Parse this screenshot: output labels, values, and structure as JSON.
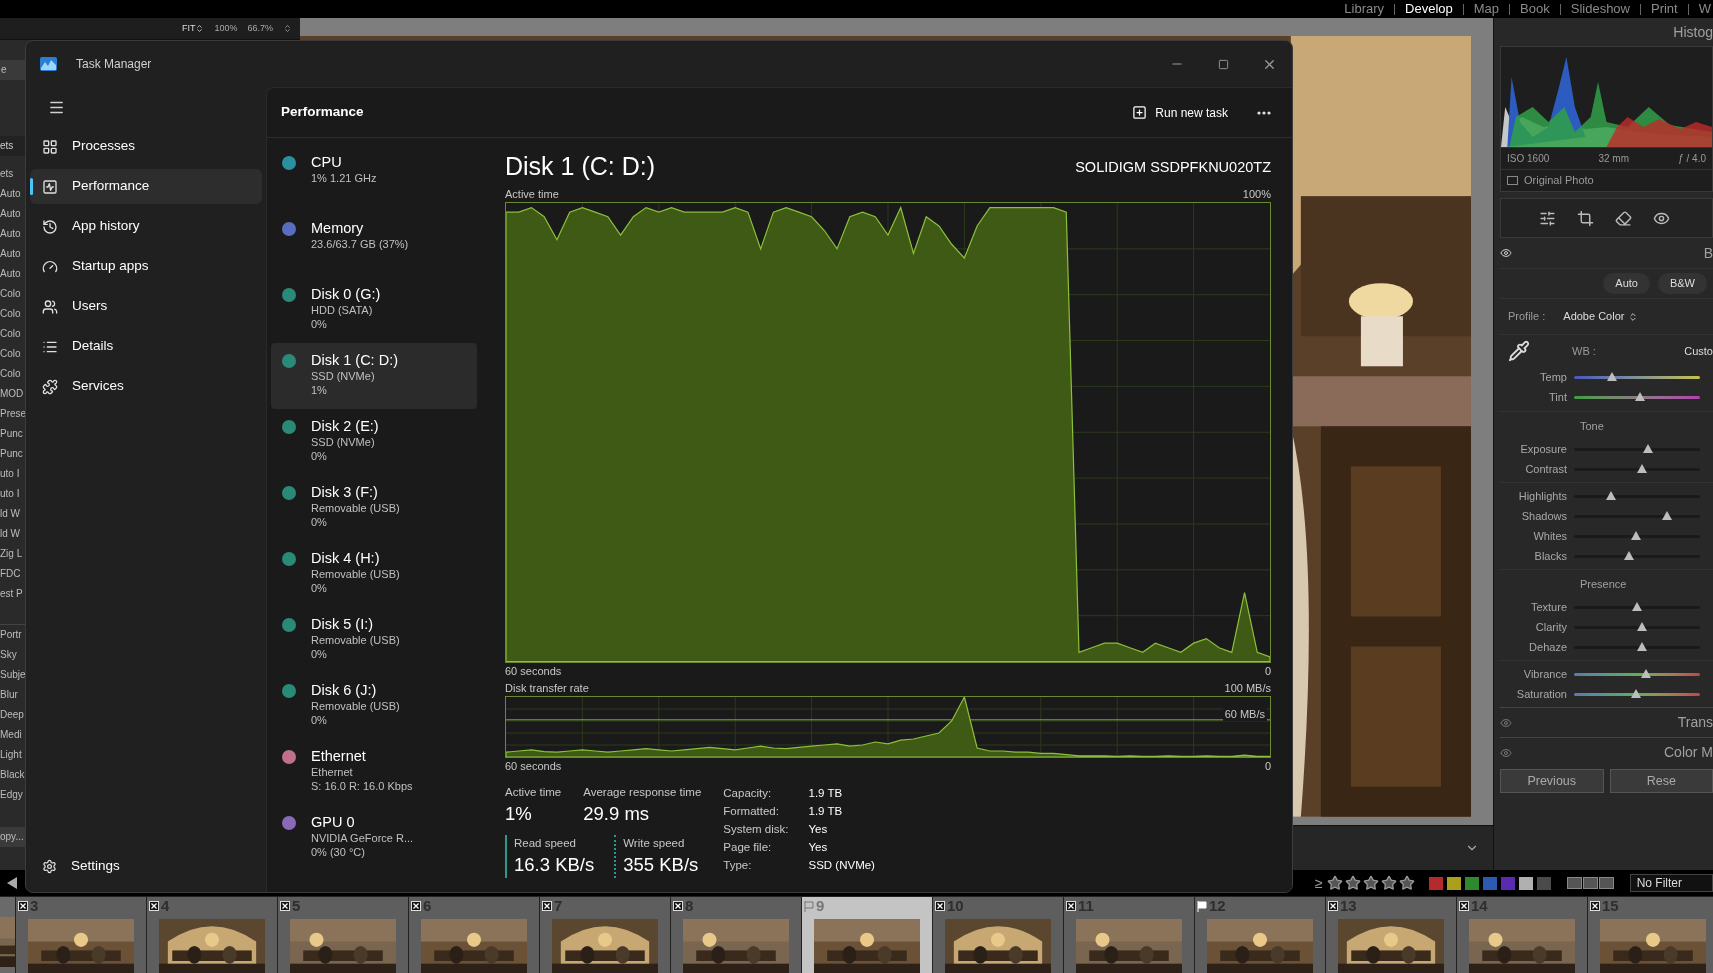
{
  "module_bar": [
    {
      "label": "Library",
      "selected": false
    },
    {
      "label": "Develop",
      "selected": true
    },
    {
      "label": "Map",
      "selected": false
    },
    {
      "label": "Book",
      "selected": false
    },
    {
      "label": "Slideshow",
      "selected": false
    },
    {
      "label": "Print",
      "selected": false
    },
    {
      "label": "W",
      "selected": false
    }
  ],
  "view_toolbar": {
    "fit": "FIT",
    "zoom_1": "100%",
    "zoom_2": "66.7%"
  },
  "left_panel": {
    "field_text": "e",
    "header": "ets",
    "items": [
      "ets",
      "Auto",
      "Auto",
      "Auto",
      "Auto",
      "Auto",
      "Colo",
      "Colo",
      "Colo",
      "Colo",
      "Colo",
      "MOD",
      "Prese",
      "Punc",
      "Punc",
      "uto I",
      "uto I",
      "ld W",
      "ld W",
      "Zig L",
      "FDC",
      "est P"
    ],
    "items_2": [
      "Portr",
      "Sky",
      "Subje",
      "Blur",
      "Deep",
      "Medi",
      "Light",
      "Black",
      "Edgy"
    ],
    "copy_button": "opy..."
  },
  "task_manager": {
    "title": "Task Manager",
    "nav": [
      {
        "label": "Processes",
        "selected": false
      },
      {
        "label": "Performance",
        "selected": true
      },
      {
        "label": "App history",
        "selected": false
      },
      {
        "label": "Startup apps",
        "selected": false
      },
      {
        "label": "Users",
        "selected": false
      },
      {
        "label": "Details",
        "selected": false
      },
      {
        "label": "Services",
        "selected": false
      }
    ],
    "settings": "Settings",
    "page_title": "Performance",
    "run_new_task": "Run new task",
    "devices": [
      {
        "name": "CPU",
        "lines": [
          "1% 1.21 GHz"
        ],
        "color": "#2a8fa0",
        "selected": false
      },
      {
        "name": "Memory",
        "lines": [
          "23.6/63.7 GB (37%)"
        ],
        "color": "#5a6cc0",
        "selected": false
      },
      {
        "name": "Disk 0 (G:)",
        "lines": [
          "HDD (SATA)",
          "0%"
        ],
        "color": "#2a8a78",
        "selected": false
      },
      {
        "name": "Disk 1 (C: D:)",
        "lines": [
          "SSD (NVMe)",
          "1%"
        ],
        "color": "#2a8a78",
        "selected": true
      },
      {
        "name": "Disk 2 (E:)",
        "lines": [
          "SSD (NVMe)",
          "0%"
        ],
        "color": "#2a8a78",
        "selected": false
      },
      {
        "name": "Disk 3 (F:)",
        "lines": [
          "Removable (USB)",
          "0%"
        ],
        "color": "#2a8a78",
        "selected": false
      },
      {
        "name": "Disk 4 (H:)",
        "lines": [
          "Removable (USB)",
          "0%"
        ],
        "color": "#2a8a78",
        "selected": false
      },
      {
        "name": "Disk 5 (I:)",
        "lines": [
          "Removable (USB)",
          "0%"
        ],
        "color": "#2a8a78",
        "selected": false
      },
      {
        "name": "Disk 6 (J:)",
        "lines": [
          "Removable (USB)",
          "0%"
        ],
        "color": "#2a8a78",
        "selected": false
      },
      {
        "name": "Ethernet",
        "lines": [
          "Ethernet",
          "S: 16.0 R: 16.0 Kbps"
        ],
        "color": "#c0708a",
        "selected": false
      },
      {
        "name": "GPU 0",
        "lines": [
          "NVIDIA GeForce R...",
          "0% (30 °C)"
        ],
        "color": "#8a6ab8",
        "selected": false
      }
    ],
    "detail": {
      "title": "Disk 1 (C: D:)",
      "model": "SOLIDIGM SSDPFKNU020TZ",
      "active_chart": {
        "title": "Active time",
        "max_label": "100%",
        "start_label": "60 seconds",
        "end_label": "0"
      },
      "transfer_chart": {
        "title": "Disk transfer rate",
        "max_label": "100 MB/s",
        "line_label": "60 MB/s",
        "start_label": "60 seconds",
        "end_label": "0"
      },
      "stats": [
        {
          "label": "Active time",
          "value": "1%"
        },
        {
          "label": "Average response time",
          "value": "29.9 ms"
        }
      ],
      "speeds": [
        {
          "label": "Read speed",
          "value": "16.3 KB/s",
          "kind": "solid"
        },
        {
          "label": "Write speed",
          "value": "355 KB/s",
          "kind": "dotted"
        }
      ],
      "properties": [
        {
          "label": "Capacity:",
          "value": "1.9 TB"
        },
        {
          "label": "Formatted:",
          "value": "1.9 TB"
        },
        {
          "label": "System disk:",
          "value": "Yes"
        },
        {
          "label": "Page file:",
          "value": "Yes"
        },
        {
          "label": "Type:",
          "value": "SSD (NVMe)"
        }
      ]
    }
  },
  "right_panel": {
    "histogram_title": "Histog",
    "exif": [
      "ISO 1600",
      "32 mm",
      "ƒ / 4.0"
    ],
    "original_photo": {
      "label": "Original Photo",
      "checked": false
    },
    "basic_title": "B",
    "buttons": [
      "Auto",
      "B&W"
    ],
    "profile_label": "Profile :",
    "profile_value": "Adobe Color",
    "wb_label": "WB :",
    "wb_value": "Custo",
    "wb_sliders": [
      {
        "label": "Temp",
        "kind": "temp",
        "level": 0.3
      },
      {
        "label": "Tint",
        "kind": "tint",
        "level": 0.52
      }
    ],
    "sections": [
      {
        "title": "Tone",
        "groups": [
          [
            {
              "label": "Exposure",
              "kind": "plain",
              "level": 0.59
            },
            {
              "label": "Contrast",
              "kind": "plain",
              "level": 0.54
            }
          ],
          [
            {
              "label": "Highlights",
              "kind": "plain",
              "level": 0.29
            },
            {
              "label": "Shadows",
              "kind": "plain",
              "level": 0.74
            },
            {
              "label": "Whites",
              "kind": "plain",
              "level": 0.49
            },
            {
              "label": "Blacks",
              "kind": "plain",
              "level": 0.44
            }
          ]
        ]
      },
      {
        "title": "Presence",
        "groups": [
          [
            {
              "label": "Texture",
              "kind": "plain",
              "level": 0.5
            },
            {
              "label": "Clarity",
              "kind": "plain",
              "level": 0.54
            },
            {
              "label": "Dehaze",
              "kind": "plain",
              "level": 0.54
            }
          ],
          [
            {
              "label": "Vibrance",
              "kind": "color",
              "level": 0.57
            },
            {
              "label": "Saturation",
              "kind": "color",
              "level": 0.49
            }
          ]
        ]
      }
    ],
    "collapsed_panels": [
      "Trans",
      "Color M"
    ],
    "footer_buttons": [
      "Previous",
      "Rese"
    ]
  },
  "bottom_bar": {
    "rating_operator": "≥",
    "stars": 0,
    "color_labels": [
      {
        "color": "#b52a2a"
      },
      {
        "color": "#aaa01a"
      },
      {
        "color": "#2f8a2f"
      },
      {
        "color": "#2c5ab0"
      },
      {
        "color": "#5a2ab0"
      },
      {
        "color": "#b0b0b0"
      },
      {
        "color": "#4a4a4a"
      }
    ],
    "filter": "No Filter"
  },
  "filmstrip": [
    {
      "number": "3",
      "kind": "reject",
      "selected": false
    },
    {
      "number": "4",
      "kind": "reject",
      "selected": false
    },
    {
      "number": "5",
      "kind": "reject",
      "selected": false
    },
    {
      "number": "6",
      "kind": "reject",
      "selected": false
    },
    {
      "number": "7",
      "kind": "reject",
      "selected": false
    },
    {
      "number": "8",
      "kind": "reject",
      "selected": false
    },
    {
      "number": "9",
      "kind": "outline",
      "selected": true
    },
    {
      "number": "10",
      "kind": "reject",
      "selected": false
    },
    {
      "number": "11",
      "kind": "reject",
      "selected": false
    },
    {
      "number": "12",
      "kind": "pick",
      "selected": false
    },
    {
      "number": "13",
      "kind": "reject",
      "selected": false
    },
    {
      "number": "14",
      "kind": "reject",
      "selected": false
    },
    {
      "number": "15",
      "kind": "reject",
      "selected": false
    }
  ]
}
